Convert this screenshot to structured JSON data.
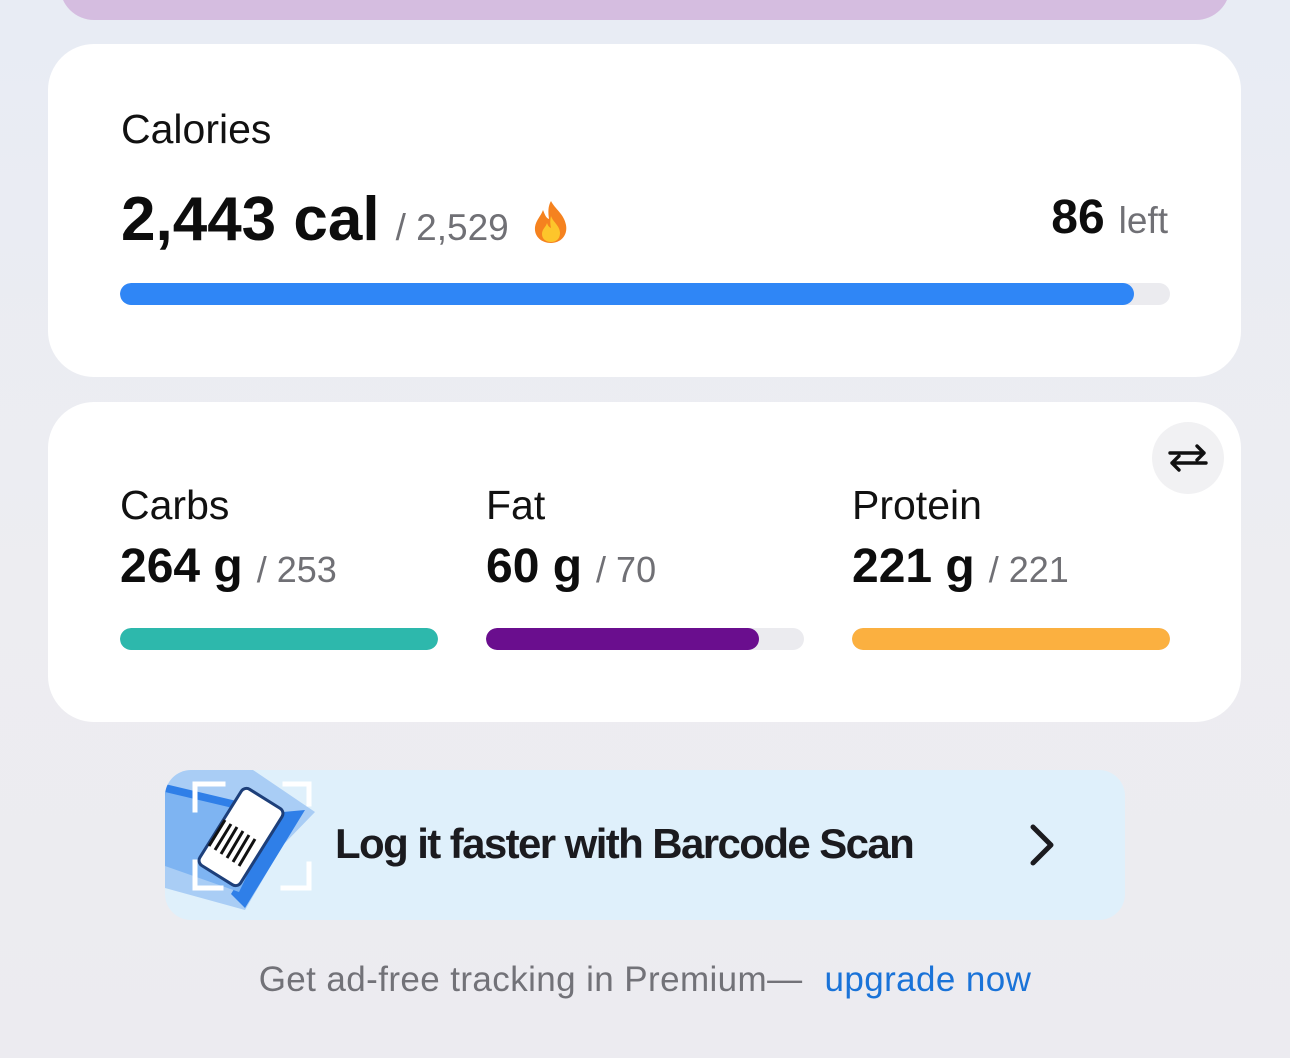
{
  "calories": {
    "title": "Calories",
    "consumed": "2,443 cal",
    "goal": "/ 2,529",
    "left_value": "86",
    "left_label": "left",
    "progress": 0.966,
    "bar_color": "#2f86f6"
  },
  "macros": [
    {
      "name": "Carbs",
      "value": "264 g",
      "goal": "/ 253",
      "progress": 1.0,
      "color": "#2db8ac"
    },
    {
      "name": "Fat",
      "value": "60 g",
      "goal": "/ 70",
      "progress": 0.857,
      "color": "#6a0e8e"
    },
    {
      "name": "Protein",
      "value": "221 g",
      "goal": "/ 221",
      "progress": 1.0,
      "color": "#fbb040"
    }
  ],
  "swap_icon": "swap-arrows-icon",
  "banner": {
    "text": "Log it faster with Barcode Scan",
    "icon": "barcode-scan-icon"
  },
  "footer": {
    "text": "Get ad-free tracking in Premium—",
    "link": "upgrade now"
  }
}
